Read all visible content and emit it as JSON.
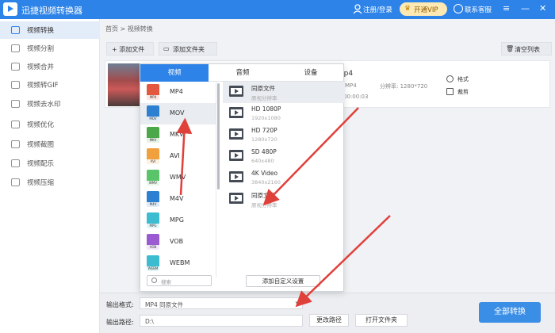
{
  "titlebar": {
    "app_title": "迅捷视频转换器",
    "login": "注册/登录",
    "vip": "开通VIP",
    "service": "联系客服",
    "menu": "≡",
    "minimize": "—",
    "close": "✕"
  },
  "sidebar": {
    "items": [
      {
        "label": "视频转换",
        "icon": "video-convert-icon",
        "active": true
      },
      {
        "label": "视频分割",
        "icon": "video-split-icon"
      },
      {
        "label": "视频合并",
        "icon": "video-merge-icon"
      },
      {
        "label": "视频转GIF",
        "icon": "gif-icon"
      },
      {
        "label": "视频去水印",
        "icon": "watermark-icon"
      },
      {
        "label": "视频优化",
        "icon": "optimize-icon"
      },
      {
        "label": "视频截图",
        "icon": "screenshot-icon"
      },
      {
        "label": "视频配乐",
        "icon": "music-icon"
      },
      {
        "label": "视频压缩",
        "icon": "compress-icon"
      }
    ]
  },
  "main": {
    "breadcrumb": "首页 > 视频转换",
    "add_file": "+ 添加文件",
    "add_folder": "添加文件夹",
    "clear_list": "清空列表"
  },
  "file_row": {
    "name_suffix": "蓖.mp4",
    "format": "MP4",
    "resolution": "分辨率: 1280*720",
    "duration": "00:00:03",
    "duration_prefix": "0",
    "format_label": "格式",
    "clip_label": "裁剪"
  },
  "popup": {
    "tabs": [
      {
        "label": "视频",
        "active": true
      },
      {
        "label": "音频"
      },
      {
        "label": "设备"
      }
    ],
    "formats": [
      {
        "name": "MP4",
        "color": "#e2573d"
      },
      {
        "name": "MOV",
        "color": "#2d7fd1",
        "active": true
      },
      {
        "name": "MKV",
        "color": "#4aa84a"
      },
      {
        "name": "AVI",
        "color": "#f0a03c"
      },
      {
        "name": "WMV",
        "color": "#5ac46a"
      },
      {
        "name": "M4V",
        "color": "#2d7fd1"
      },
      {
        "name": "MPG",
        "color": "#3bbcd1"
      },
      {
        "name": "VOB",
        "color": "#9a5ad1"
      },
      {
        "name": "WEBM",
        "color": "#3bbcd1"
      }
    ],
    "resolutions": [
      {
        "title": "同原文件",
        "sub": "原视分辨率",
        "active": true
      },
      {
        "title": "HD 1080P",
        "sub": "1920x1080"
      },
      {
        "title": "HD 720P",
        "sub": "1280x720"
      },
      {
        "title": "SD 480P",
        "sub": "640x480"
      },
      {
        "title": "4K Video",
        "sub": "3840x2160"
      },
      {
        "title": "同原文件",
        "sub": "原视分辨率"
      }
    ],
    "search_placeholder": "搜索",
    "custom_settings": "添加自定义设置"
  },
  "bottom": {
    "output_format_label": "输出格式:",
    "output_format_value": "MP4  同原文件",
    "output_path_label": "输出路径:",
    "output_path_value": "D:\\",
    "change_path": "更改路径",
    "open_folder": "打开文件夹",
    "convert_all": "全部转换"
  },
  "colors": {
    "accent": "#2d83e8",
    "arrow": "#e0403a"
  }
}
